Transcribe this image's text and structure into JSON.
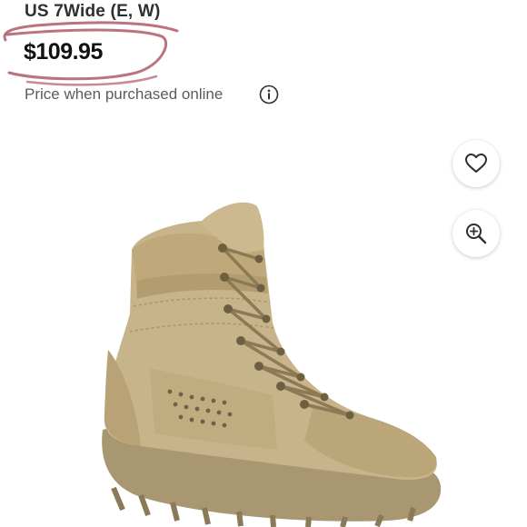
{
  "product": {
    "size_label": "US 7Wide (E, W)",
    "price": "$109.95",
    "price_note": "Price when purchased online"
  },
  "icons": {
    "info": "info-icon",
    "favorite": "heart-icon",
    "zoom": "zoom-in-icon"
  },
  "colors": {
    "annotation_scribble": "#b05a6a",
    "boot_tan": "#c8b48a"
  }
}
